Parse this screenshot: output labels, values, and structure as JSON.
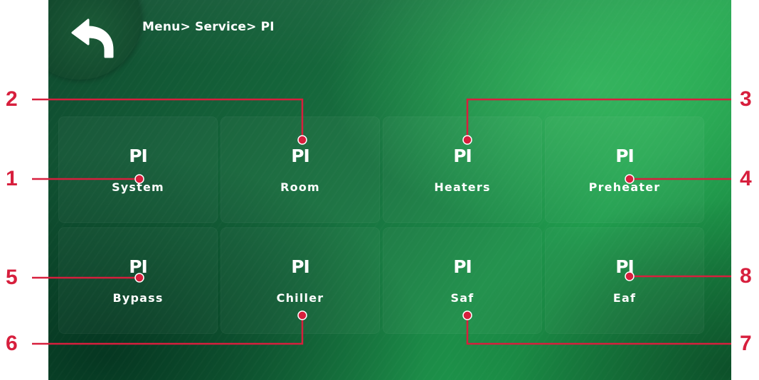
{
  "header": {
    "breadcrumb": "Menu> Service> PI",
    "back_icon": "back-arrow-icon"
  },
  "tiles": [
    {
      "title": "PI",
      "label": "System"
    },
    {
      "title": "PI",
      "label": "Room"
    },
    {
      "title": "PI",
      "label": "Heaters"
    },
    {
      "title": "PI",
      "label": "Preheater"
    },
    {
      "title": "PI",
      "label": "Bypass"
    },
    {
      "title": "PI",
      "label": "Chiller"
    },
    {
      "title": "PI",
      "label": "Saf"
    },
    {
      "title": "PI",
      "label": "Eaf"
    }
  ],
  "callouts": [
    "1",
    "2",
    "3",
    "4",
    "5",
    "6",
    "7",
    "8"
  ],
  "colors": {
    "callout": "#d71f3d",
    "screen_green": "#1e9a4c",
    "text": "#ffffff"
  }
}
